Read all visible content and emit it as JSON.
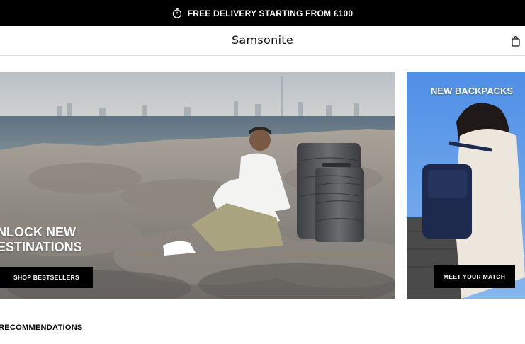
{
  "promo": {
    "text": "FREE DELIVERY STARTING FROM £100",
    "icon": "stopwatch-icon"
  },
  "header": {
    "logo": "Samsonite",
    "cart_icon": "shopping-bag-icon"
  },
  "hero": {
    "headline": "NLOCK NEW\nESTINATIONS",
    "cta_label": "SHOP BESTSELLERS"
  },
  "side_promo": {
    "headline": "NEW BACKPACKS",
    "cta_label": "MEET YOUR MATCH"
  },
  "recommendations": {
    "title": "RECOMMENDATIONS"
  },
  "colors": {
    "promo_bg": "#000000",
    "button_bg": "#000000",
    "button_text": "#ffffff"
  }
}
